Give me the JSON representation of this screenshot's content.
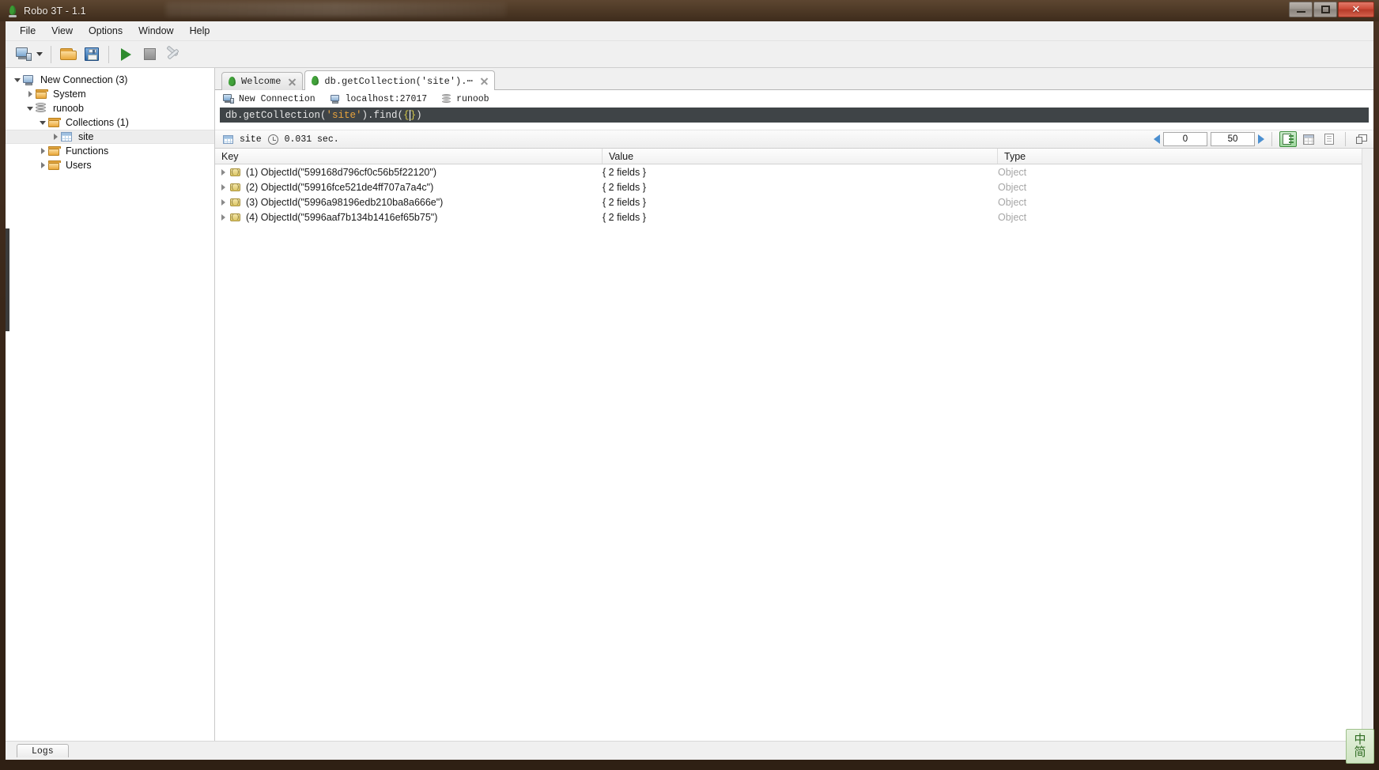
{
  "window": {
    "title": "Robo 3T - 1.1",
    "app_icon": "leaf-icon",
    "minimize_label": "",
    "maximize_label": "",
    "close_label": "✕"
  },
  "menu": {
    "items": [
      {
        "label": "File"
      },
      {
        "label": "View"
      },
      {
        "label": "Options"
      },
      {
        "label": "Window"
      },
      {
        "label": "Help"
      }
    ]
  },
  "toolbar": {
    "buttons": [
      {
        "name": "connect-button",
        "icon": "computer-icon"
      },
      {
        "name": "connect-dropdown",
        "icon": "chevron-down-icon"
      },
      {
        "name": "open-script-button",
        "icon": "folder-icon"
      },
      {
        "name": "save-script-button",
        "icon": "save-icon"
      },
      {
        "name": "execute-button",
        "icon": "play-icon"
      },
      {
        "name": "stop-button",
        "icon": "stop-icon"
      },
      {
        "name": "tools-button",
        "icon": "wrench-icon"
      }
    ]
  },
  "sidebar": {
    "tree": [
      {
        "label": "New Connection (3)",
        "icon": "computer-icon",
        "indent": 0,
        "state": "expanded",
        "selected": false
      },
      {
        "label": "System",
        "icon": "folder-icon",
        "indent": 1,
        "state": "collapsed",
        "selected": false
      },
      {
        "label": "runoob",
        "icon": "database-icon",
        "indent": 1,
        "state": "expanded",
        "selected": false
      },
      {
        "label": "Collections (1)",
        "icon": "folder-icon",
        "indent": 2,
        "state": "expanded",
        "selected": false
      },
      {
        "label": "site",
        "icon": "collection-grid-icon",
        "indent": 3,
        "state": "collapsed",
        "selected": true
      },
      {
        "label": "Functions",
        "icon": "folder-icon",
        "indent": 2,
        "state": "collapsed",
        "selected": false
      },
      {
        "label": "Users",
        "icon": "folder-icon",
        "indent": 2,
        "state": "collapsed",
        "selected": false
      }
    ]
  },
  "tabs": [
    {
      "label": "Welcome",
      "icon": "leaf-icon",
      "active": false,
      "closable": true
    },
    {
      "label": "db.getCollection('site').⋯",
      "icon": "leaf-icon",
      "active": true,
      "closable": true
    }
  ],
  "connection_bar": {
    "connection_name": "New Connection",
    "host": "localhost:27017",
    "database": "runoob"
  },
  "editor": {
    "segments": [
      {
        "text": "db.getCollection(",
        "type": "plain"
      },
      {
        "text": "'site'",
        "type": "string"
      },
      {
        "text": ").find(",
        "type": "plain"
      },
      {
        "text": "{",
        "type": "brace"
      },
      {
        "text": "}",
        "type": "brace"
      },
      {
        "text": ")",
        "type": "plain"
      }
    ],
    "full_text": "db.getCollection('site').find({})"
  },
  "result_bar": {
    "collection": "site",
    "elapsed": "0.031 sec.",
    "skip": "0",
    "limit": "50",
    "prev_label": "",
    "next_label": "",
    "view_buttons": [
      {
        "name": "tree-view-button",
        "icon": "tree-view-icon",
        "active": true
      },
      {
        "name": "table-view-button",
        "icon": "table-view-icon",
        "active": false
      },
      {
        "name": "text-view-button",
        "icon": "document-view-icon",
        "active": false
      },
      {
        "name": "detach-window-button",
        "icon": "window-icon",
        "active": false
      }
    ]
  },
  "results": {
    "columns": [
      "Key",
      "Value",
      "Type"
    ],
    "rows": [
      {
        "key": "(1) ObjectId(\"599168d796cf0c56b5f22120\")",
        "value": "{ 2 fields }",
        "type": "Object"
      },
      {
        "key": "(2) ObjectId(\"59916fce521de4ff707a7a4c\")",
        "value": "{ 2 fields }",
        "type": "Object"
      },
      {
        "key": "(3) ObjectId(\"5996a98196edb210ba8a666e\")",
        "value": "{ 2 fields }",
        "type": "Object"
      },
      {
        "key": "(4) ObjectId(\"5996aaf7b134b1416ef65b75\")",
        "value": "{ 2 fields }",
        "type": "Object"
      }
    ]
  },
  "status": {
    "logs_label": "Logs"
  },
  "ime": {
    "line1": "中",
    "line2": "简"
  },
  "colors": {
    "accent_green": "#3d8c3d",
    "editor_bg": "#3f4447",
    "string_token": "#e8a33d",
    "brace_token": "#d4c84a",
    "selection_bg": "#ededed",
    "close_button": "#cf4b38"
  }
}
